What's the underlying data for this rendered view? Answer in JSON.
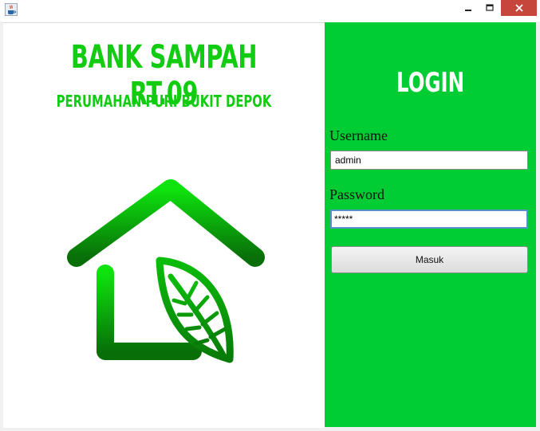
{
  "window": {
    "icon": "java-cup-icon",
    "controls": [
      "minimize-icon",
      "maximize-icon",
      "close-icon"
    ]
  },
  "branding": {
    "title": "BANK SAMPAH RT.09",
    "subtitle": "PERUMAHAN PURI BUKIT DEPOK",
    "logo": "house-leaf-logo",
    "brand_color": "#11cc11"
  },
  "login": {
    "heading": "LOGIN",
    "panel_color": "#00cc33",
    "username_label": "Username",
    "username_value": "admin",
    "password_label": "Password",
    "password_value": "*****",
    "submit_label": "Masuk"
  }
}
